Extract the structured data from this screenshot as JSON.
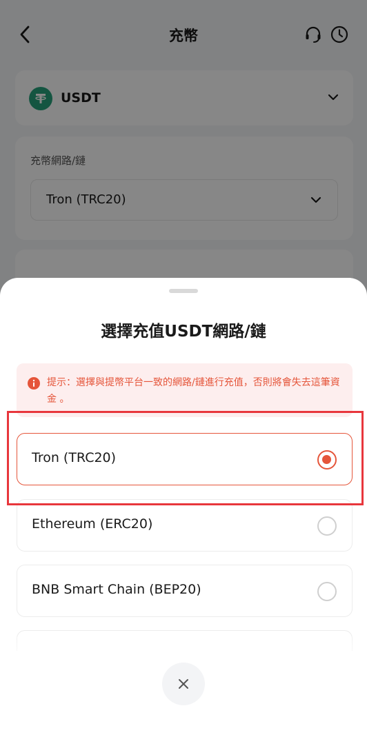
{
  "header": {
    "title": "充幣",
    "back_icon": "chevron-left-icon",
    "support_icon": "headset-icon",
    "history_icon": "clock-icon"
  },
  "coin": {
    "name": "USDT",
    "icon": "tether-icon",
    "icon_color": "#26a17b"
  },
  "network": {
    "label": "充幣網路/鏈",
    "value": "Tron (TRC20)"
  },
  "sheet": {
    "title": "選擇充值USDT網路/鏈",
    "warning": "提示：選擇與提幣平台一致的網路/鏈進行充值，否則將會失去這筆資金 。",
    "options": [
      {
        "label": "Tron (TRC20)",
        "selected": true
      },
      {
        "label": "Ethereum (ERC20)",
        "selected": false
      },
      {
        "label": "BNB Smart Chain (BEP20)",
        "selected": false
      }
    ],
    "close_icon": "close-icon"
  },
  "colors": {
    "accent": "#e5553a",
    "warning_bg": "#fdeeee",
    "highlight": "#e8363c"
  }
}
